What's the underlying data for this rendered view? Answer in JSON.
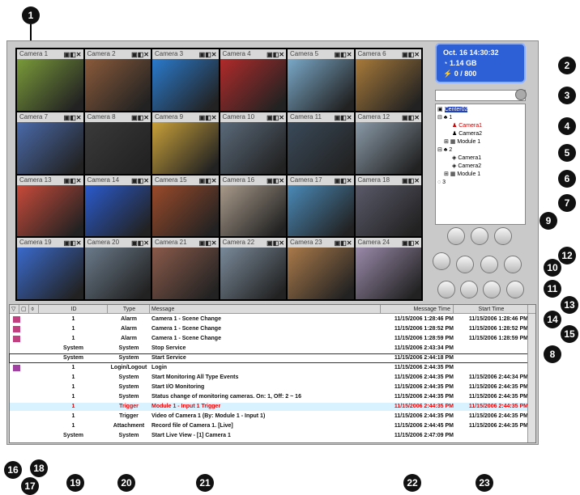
{
  "callouts": [
    "1",
    "2",
    "3",
    "4",
    "5",
    "6",
    "7",
    "8",
    "9",
    "10",
    "11",
    "12",
    "13",
    "14",
    "15",
    "16",
    "17",
    "18",
    "19",
    "20",
    "21",
    "22",
    "23"
  ],
  "cameras": [
    {
      "name": "Camera 1",
      "color": "#7a9a3a"
    },
    {
      "name": "Camera 2",
      "color": "#8a5a3a"
    },
    {
      "name": "Camera 3",
      "color": "#2a7acc"
    },
    {
      "name": "Camera 4",
      "color": "#b02a2a"
    },
    {
      "name": "Camera 5",
      "color": "#7aa8c8"
    },
    {
      "name": "Camera 6",
      "color": "#a87a3a"
    },
    {
      "name": "Camera 7",
      "color": "#4a6aaa"
    },
    {
      "name": "Camera 8",
      "color": "#3a3a3a"
    },
    {
      "name": "Camera 9",
      "color": "#c8a03a"
    },
    {
      "name": "Camera 10",
      "color": "#5a6a7a"
    },
    {
      "name": "Camera 11",
      "color": "#3a4a5a"
    },
    {
      "name": "Camera 12",
      "color": "#8a9aa8"
    },
    {
      "name": "Camera 13",
      "color": "#c84a3a"
    },
    {
      "name": "Camera 14",
      "color": "#2a5acc"
    },
    {
      "name": "Camera 15",
      "color": "#9a4a2a"
    },
    {
      "name": "Camera 16",
      "color": "#a89a8a"
    },
    {
      "name": "Camera 17",
      "color": "#4a8ab8"
    },
    {
      "name": "Camera 18",
      "color": "#5a5a6a"
    },
    {
      "name": "Camera 19",
      "color": "#3a6acc"
    },
    {
      "name": "Camera 20",
      "color": "#6a7a8a"
    },
    {
      "name": "Camera 21",
      "color": "#8a5a4a"
    },
    {
      "name": "Camera 22",
      "color": "#7a8a9a"
    },
    {
      "name": "Camera 23",
      "color": "#aa7a4a"
    },
    {
      "name": "Camera 24",
      "color": "#9a8aaa"
    }
  ],
  "cam_icons": "▣◧✕",
  "status": {
    "date": "Oct. 16 14:30:32",
    "disk": "1.14 GB",
    "count": "0 / 800"
  },
  "tree": {
    "root": "Center02",
    "node1": "1",
    "cam1a": "Camera1",
    "cam1b": "Camera2",
    "mod1": "Module 1",
    "node2": "2",
    "cam2a": "Camera1",
    "cam2b": "Camera2",
    "mod2": "Module 1",
    "node3": "3"
  },
  "table": {
    "headers": {
      "id": "ID",
      "type": "Type",
      "message": "Message",
      "mtime": "Message Time",
      "stime": "Start Time"
    },
    "rows": [
      {
        "id": "1",
        "type": "Alarm",
        "message": "Camera 1 - Scene Change",
        "mtime": "11/15/2006 1:28:46 PM",
        "stime": "11/15/2006 1:28:46 PM"
      },
      {
        "id": "1",
        "type": "Alarm",
        "message": "Camera 1 - Scene Change",
        "mtime": "11/15/2006 1:28:52 PM",
        "stime": "11/15/2006 1:28:52 PM"
      },
      {
        "id": "1",
        "type": "Alarm",
        "message": "Camera 1 - Scene Change",
        "mtime": "11/15/2006 1:28:59 PM",
        "stime": "11/15/2006 1:28:59 PM"
      },
      {
        "id": "System",
        "type": "System",
        "message": "Stop Service",
        "mtime": "11/15/2006 2:43:34 PM",
        "stime": ""
      },
      {
        "id": "System",
        "type": "System",
        "message": "Start Service",
        "mtime": "11/15/2006 2:44:18 PM",
        "stime": ""
      },
      {
        "id": "1",
        "type": "Login/Logout",
        "message": "Login",
        "mtime": "11/15/2006 2:44:35 PM",
        "stime": ""
      },
      {
        "id": "1",
        "type": "System",
        "message": "Start Monitoring All Type Events",
        "mtime": "11/15/2006 2:44:35 PM",
        "stime": "11/15/2006 2:44:34 PM"
      },
      {
        "id": "1",
        "type": "System",
        "message": "Start I/O Monitoring",
        "mtime": "11/15/2006 2:44:35 PM",
        "stime": "11/15/2006 2:44:35 PM"
      },
      {
        "id": "1",
        "type": "System",
        "message": "Status change of monitoring cameras. On: 1, Off: 2 ~ 16",
        "mtime": "11/15/2006 2:44:35 PM",
        "stime": "11/15/2006 2:44:35 PM"
      },
      {
        "id": "1",
        "type": "Trigger",
        "message": "Module 1 - Input 1 Trigger",
        "mtime": "11/15/2006 2:44:35 PM",
        "stime": "11/15/2006 2:44:35 PM"
      },
      {
        "id": "1",
        "type": "Trigger",
        "message": "Video of Camera 1 (By: Module 1 - Input 1)",
        "mtime": "11/15/2006 2:44:35 PM",
        "stime": "11/15/2006 2:44:35 PM"
      },
      {
        "id": "1",
        "type": "Attachment",
        "message": "Record file of Camera 1. [Live]",
        "mtime": "11/15/2006 2:44:45 PM",
        "stime": "11/15/2006 2:44:35 PM"
      },
      {
        "id": "System",
        "type": "System",
        "message": "Start Live View - [1] Camera 1",
        "mtime": "11/15/2006 2:47:09 PM",
        "stime": ""
      }
    ]
  }
}
